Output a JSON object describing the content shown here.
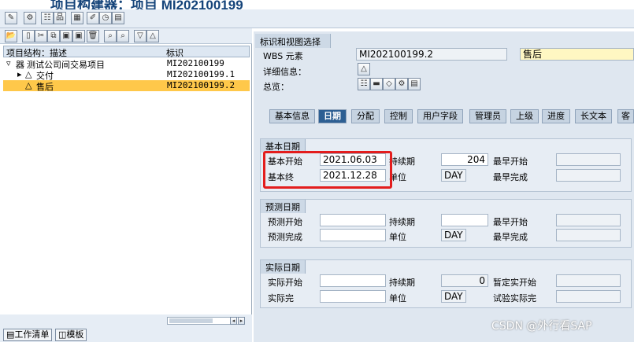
{
  "title": "项目构建器：项目 MI202100199",
  "tree": {
    "head_desc": "项目结构：描述",
    "head_id": "标识",
    "rows": [
      {
        "desc": "测试公司间交易项目",
        "id": "MI202100199"
      },
      {
        "desc": "交付",
        "id": "MI202100199.1"
      },
      {
        "desc": "售后",
        "id": "MI202100199.2"
      }
    ]
  },
  "bottom_tabs": [
    "工作清单",
    "模板"
  ],
  "right": {
    "section_title": "标识和视图选择",
    "wbs_label": "WBS 元素",
    "wbs_value": "MI202100199.2",
    "wbs_desc": "售后",
    "detail_label": "详细信息：",
    "overview_label": "总览："
  },
  "tabs": [
    "基本信息",
    "日期",
    "分配",
    "控制",
    "用户字段",
    "管理员",
    "上级",
    "进度",
    "长文本",
    "客"
  ],
  "active_tab": "日期",
  "basic": {
    "title": "基本日期",
    "start_label": "基本开始",
    "start": "2021.06.03",
    "dur_label": "持续期",
    "dur": "204",
    "earliest_start_label": "最早开始",
    "end_label": "基本终",
    "end": "2021.12.28",
    "unit_label": "单位",
    "unit": "DAY",
    "earliest_finish_label": "最早完成"
  },
  "forecast": {
    "title": "预测日期",
    "start_label": "预测开始",
    "dur_label": "持续期",
    "earliest_start_label": "最早开始",
    "end_label": "预测完成",
    "unit_label": "单位",
    "unit": "DAY",
    "earliest_finish_label": "最早完成"
  },
  "actual": {
    "title": "实际日期",
    "start_label": "实际开始",
    "dur_label": "持续期",
    "dur": "0",
    "tentative_label": "暂定实开始",
    "end_label": "实际完",
    "unit_label": "单位",
    "unit": "DAY",
    "test_label": "试验实际完"
  },
  "watermark": "CSDN @外行看SAP",
  "colors": {
    "highlight": "#ffc84a",
    "active_tab": "#2d5f93",
    "red_box": "#e31d1d",
    "title": "#15447a"
  }
}
